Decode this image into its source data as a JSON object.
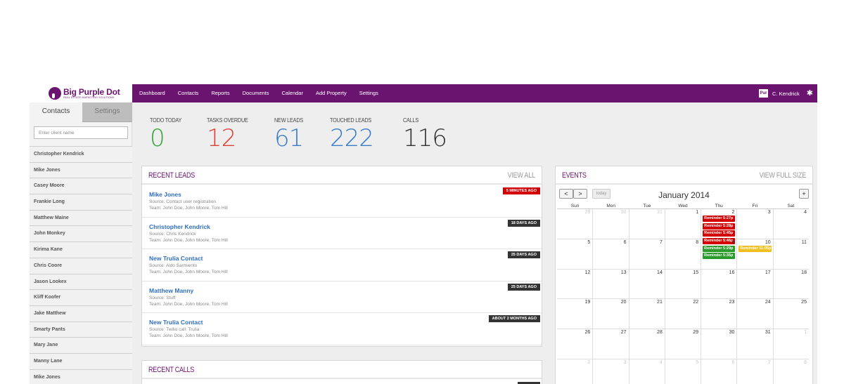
{
  "brand": {
    "name": "Big Purple Dot",
    "tagline": "REAL ESTATE MARKETING SOLUTIONS",
    "color": "#6a1470"
  },
  "nav": [
    "Dashboard",
    "Contacts",
    "Reports",
    "Documents",
    "Calendar",
    "Add Property",
    "Settings"
  ],
  "user": {
    "avatar_text": "Pur",
    "name": "C. Kendrick",
    "settings_icon": "gear-icon"
  },
  "sidebar": {
    "tabs": {
      "contacts": "Contacts",
      "settings": "Settings"
    },
    "search_placeholder": "Enter client name",
    "contacts": [
      "Christopher Kendrick",
      "Mike Jones",
      "Casey Moore",
      "Frankie Long",
      "Matthew Maine",
      "John Monkey",
      "Kirima Kane",
      "Chris Coore",
      "Jason Lookex",
      "Kliff Koofer",
      "Jake Matthew",
      "Smarty Pants",
      "Mary Jane",
      "Manny Lane",
      "Mike Jones"
    ]
  },
  "stats": [
    {
      "label": "TODO TODAY",
      "value": "0",
      "color": "#3aa53a"
    },
    {
      "label": "TASKS OVERDUE",
      "value": "12",
      "color": "#d9433a"
    },
    {
      "label": "NEW LEADS",
      "value": "61",
      "color": "#3a7cc8"
    },
    {
      "label": "TOUCHED LEADS",
      "value": "222",
      "color": "#3a7cc8"
    },
    {
      "label": "CALLS",
      "value": "116",
      "color": "#333333"
    }
  ],
  "recent_leads": {
    "title": "RECENT LEADS",
    "link": "VIEW ALL",
    "items": [
      {
        "name": "Mike Jones",
        "source": "Source: Contact user registration",
        "team": "Team: John Doe, John Moore, Tom Hill",
        "badge": "5 MINUTES AGO",
        "badge_color": "red"
      },
      {
        "name": "Christopher Kendrick",
        "source": "Source: Chris Kendrick",
        "team": "Team: John Doe, John Moore, Tom Hill",
        "badge": "18 DAYS AGO",
        "badge_color": "dark"
      },
      {
        "name": "New Trulia Contact",
        "source": "Source: Aldo Sarmiento",
        "team": "Team: John Doe, John Moore, Tom Hill",
        "badge": "25 DAYS AGO",
        "badge_color": "dark"
      },
      {
        "name": "Matthew Manny",
        "source": "Source: Stuff",
        "team": "Team: John Doe, John Moore, Tom Hill",
        "badge": "25 DAYS AGO",
        "badge_color": "dark"
      },
      {
        "name": "New Trulia Contact",
        "source": "Source: Twilio call: Trulia",
        "team": "Team: John Doe, John Moore, Tom Hill",
        "badge": "ABOUT 2 MONTHS AGO",
        "badge_color": "dark"
      }
    ]
  },
  "recent_calls": {
    "title": "RECENT CALLS"
  },
  "events": {
    "title": "EVENTS",
    "link": "VIEW FULL SIZE",
    "calendar": {
      "month_title": "January 2014",
      "today_label": "today",
      "prev": "<",
      "next": ">",
      "add": "+",
      "weekdays": [
        "Sun",
        "Mon",
        "Tue",
        "Wed",
        "Thu",
        "Fri",
        "Sat"
      ],
      "weeks": [
        [
          {
            "d": "29",
            "o": true
          },
          {
            "d": "30",
            "o": true
          },
          {
            "d": "31",
            "o": true
          },
          {
            "d": "1"
          },
          {
            "d": "2"
          },
          {
            "d": "3"
          },
          {
            "d": "4"
          }
        ],
        [
          {
            "d": "5"
          },
          {
            "d": "6"
          },
          {
            "d": "7"
          },
          {
            "d": "8"
          },
          {
            "d": "9"
          },
          {
            "d": "10"
          },
          {
            "d": "11"
          }
        ],
        [
          {
            "d": "12"
          },
          {
            "d": "13"
          },
          {
            "d": "14"
          },
          {
            "d": "15"
          },
          {
            "d": "16"
          },
          {
            "d": "17"
          },
          {
            "d": "18"
          }
        ],
        [
          {
            "d": "19"
          },
          {
            "d": "20"
          },
          {
            "d": "21"
          },
          {
            "d": "22"
          },
          {
            "d": "23"
          },
          {
            "d": "24"
          },
          {
            "d": "25"
          }
        ],
        [
          {
            "d": "26"
          },
          {
            "d": "27"
          },
          {
            "d": "28"
          },
          {
            "d": "29"
          },
          {
            "d": "30"
          },
          {
            "d": "31"
          },
          {
            "d": "1",
            "o": true
          }
        ],
        [
          {
            "d": "2",
            "o": true
          },
          {
            "d": "3",
            "o": true
          },
          {
            "d": "4",
            "o": true
          },
          {
            "d": "5",
            "o": true
          },
          {
            "d": "6",
            "o": true
          },
          {
            "d": "7",
            "o": true
          },
          {
            "d": "8",
            "o": true
          }
        ]
      ],
      "events": [
        {
          "week": 0,
          "day": 4,
          "label": "Reminder  5:27p",
          "color": "#d40000"
        },
        {
          "week": 0,
          "day": 4,
          "label": "Reminder  5:28p",
          "color": "#d40000"
        },
        {
          "week": 0,
          "day": 4,
          "label": "Reminder  5:45p",
          "color": "#d40000"
        },
        {
          "week": 0,
          "day": 4,
          "label": "Reminder  5:46p",
          "color": "#d40000"
        },
        {
          "week": 1,
          "day": 4,
          "label": "Reminder  5:29p",
          "color": "#2a9a2a"
        },
        {
          "week": 1,
          "day": 4,
          "label": "Reminder  5:35p",
          "color": "#2a9a2a"
        },
        {
          "week": 1,
          "day": 5,
          "label": "Reminder 11:05p",
          "color": "#f0c020"
        }
      ]
    }
  }
}
